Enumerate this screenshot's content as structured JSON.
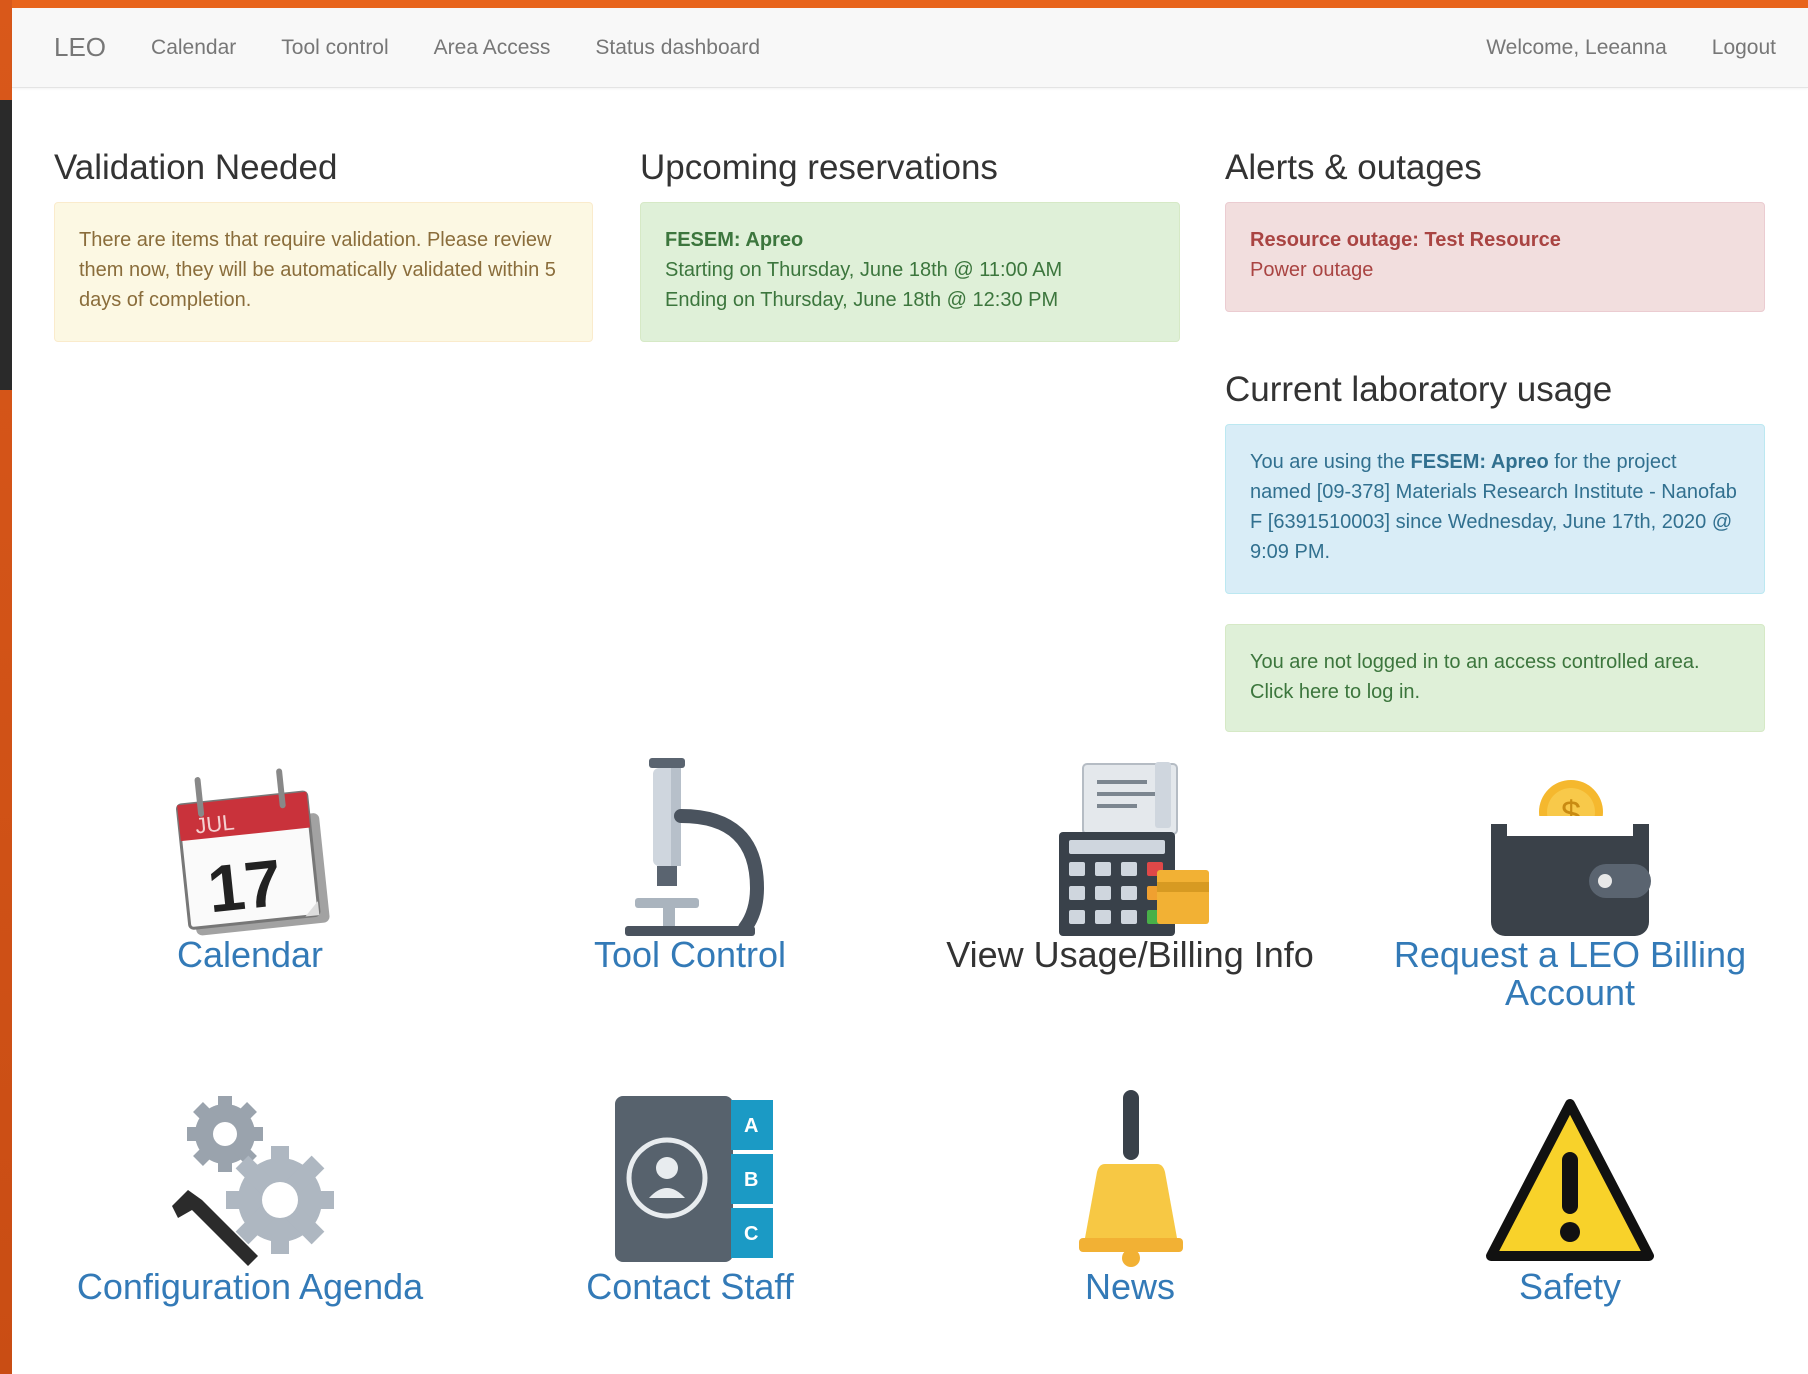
{
  "nav": {
    "brand": "LEO",
    "links": [
      "Calendar",
      "Tool control",
      "Area Access",
      "Status dashboard"
    ],
    "welcome": "Welcome, Leeanna",
    "logout": "Logout"
  },
  "validation": {
    "title": "Validation Needed",
    "text": "There are items that require validation. Please review them now, they will be automatically validated within 5 days of completion."
  },
  "reservations": {
    "title": "Upcoming reservations",
    "tool": "FESEM: Apreo",
    "start": "Starting on Thursday, June 18th @ 11:00 AM",
    "end": "Ending on Thursday, June 18th @ 12:30 PM"
  },
  "alerts": {
    "title": "Alerts & outages",
    "heading": "Resource outage: Test Resource",
    "detail": "Power outage"
  },
  "usage": {
    "title": "Current laboratory usage",
    "prefix": "You are using the",
    "tool": "FESEM: Apreo",
    "suffix": "for the project named [09-378] Materials Research Institute - Nanofab F [6391510003] since Wednesday, June 17th, 2020 @ 9:09 PM.",
    "area_text": "You are not logged in to an access controlled area. Click here to log in."
  },
  "tiles": [
    {
      "label": "Calendar",
      "icon": "calendar-icon"
    },
    {
      "label": "Tool Control",
      "icon": "microscope-icon"
    },
    {
      "label": "View Usage/Billing Info",
      "icon": "calculator-icon"
    },
    {
      "label": "Request a LEO Billing Account",
      "icon": "wallet-icon"
    },
    {
      "label": "Configuration Agenda",
      "icon": "gears-icon"
    },
    {
      "label": "Contact Staff",
      "icon": "contact-book-icon"
    },
    {
      "label": "News",
      "icon": "bell-icon"
    },
    {
      "label": "Safety",
      "icon": "warning-icon"
    }
  ],
  "calendar_icon": {
    "month": "JUL",
    "day": "17"
  },
  "contact_icon": {
    "letters": [
      "A",
      "B",
      "C"
    ]
  },
  "colors": {
    "link": "#337ab7",
    "accent": "#e8641c"
  }
}
